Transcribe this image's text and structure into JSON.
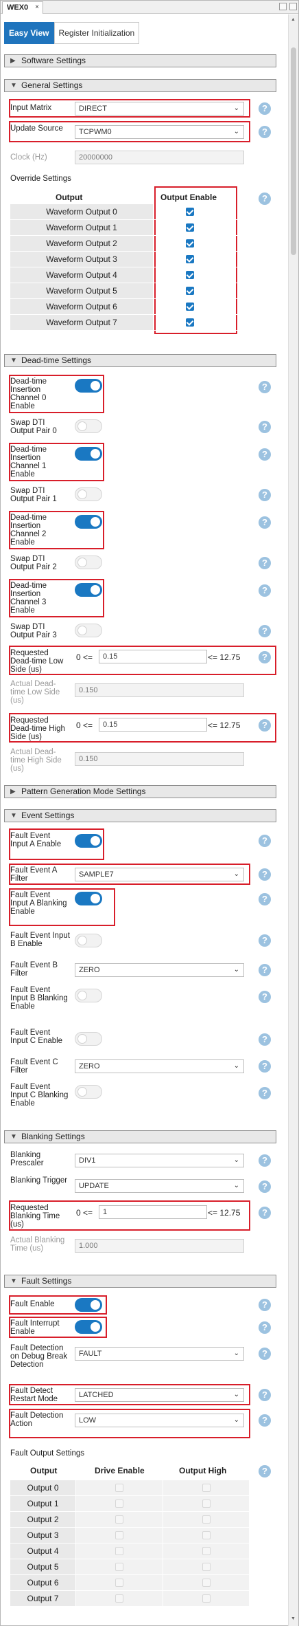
{
  "window": {
    "tab_label": "WEX0",
    "close": "×"
  },
  "view_tabs": {
    "easy": "Easy View",
    "register": "Register Initialization"
  },
  "sections": {
    "software": "Software Settings",
    "general": "General Settings",
    "deadtime": "Dead-time Settings",
    "pattern": "Pattern Generation Mode Settings",
    "event": "Event Settings",
    "blanking": "Blanking Settings",
    "fault": "Fault Settings"
  },
  "help_glyph": "?",
  "general": {
    "input_matrix": {
      "label": "Input Matrix",
      "value": "DIRECT"
    },
    "update_source": {
      "label": "Update Source",
      "value": "TCPWM0"
    },
    "clock": {
      "label": "Clock (Hz)",
      "value": "20000000"
    },
    "override_title": "Override Settings",
    "override_cols": [
      "Output",
      "Output Enable"
    ],
    "override_rows": [
      "Waveform Output 0",
      "Waveform Output 1",
      "Waveform Output 2",
      "Waveform Output 3",
      "Waveform Output 4",
      "Waveform Output 5",
      "Waveform Output 6",
      "Waveform Output 7"
    ],
    "override_enabled": [
      true,
      true,
      true,
      true,
      true,
      true,
      true,
      true
    ]
  },
  "deadtime": {
    "dti0": {
      "label": "Dead-time Insertion Channel 0 Enable",
      "on": true
    },
    "swap0": {
      "label": "Swap DTI Output Pair 0",
      "on": false
    },
    "dti1": {
      "label": "Dead-time Insertion Channel 1 Enable",
      "on": true
    },
    "swap1": {
      "label": "Swap DTI Output Pair 1",
      "on": false
    },
    "dti2": {
      "label": "Dead-time Insertion Channel 2 Enable",
      "on": true
    },
    "swap2": {
      "label": "Swap DTI Output Pair 2",
      "on": false
    },
    "dti3": {
      "label": "Dead-time Insertion Channel 3 Enable",
      "on": true
    },
    "swap3": {
      "label": "Swap DTI Output Pair 3",
      "on": false
    },
    "low": {
      "label": "Requested Dead-time Low Side (us)",
      "min": "0 <=",
      "value": "0.15",
      "max": "<= 12.75"
    },
    "actual_low": {
      "label": "Actual Dead-time Low Side (us)",
      "value": "0.150"
    },
    "high": {
      "label": "Requested Dead-time High Side (us)",
      "min": "0 <=",
      "value": "0.15",
      "max": "<= 12.75"
    },
    "actual_high": {
      "label": "Actual Dead-time High Side (us)",
      "value": "0.150"
    }
  },
  "event": {
    "fa_en": {
      "label": "Fault Event Input A Enable",
      "on": true
    },
    "fa_filter": {
      "label": "Fault Event A Filter",
      "value": "SAMPLE7"
    },
    "fa_blank": {
      "label": "Fault Event Input A Blanking Enable",
      "on": true
    },
    "fb_en": {
      "label": "Fault Event Input B Enable",
      "on": false
    },
    "fb_filter": {
      "label": "Fault Event B Filter",
      "value": "ZERO"
    },
    "fb_blank": {
      "label": "Fault Event Input B Blanking Enable",
      "on": false
    },
    "fc_en": {
      "label": "Fault Event Input C Enable",
      "on": false
    },
    "fc_filter": {
      "label": "Fault Event C Filter",
      "value": "ZERO"
    },
    "fc_blank": {
      "label": "Fault Event Input C Blanking Enable",
      "on": false
    }
  },
  "blanking": {
    "prescaler": {
      "label": "Blanking Prescaler",
      "value": "DIV1"
    },
    "trigger": {
      "label": "Blanking Trigger",
      "value": "UPDATE"
    },
    "req": {
      "label": "Requested Blanking Time (us)",
      "min": "0 <=",
      "value": "1",
      "max": "<= 12.75"
    },
    "actual": {
      "label": "Actual Blanking Time (us)",
      "value": "1.000"
    }
  },
  "fault": {
    "enable": {
      "label": "Fault Enable",
      "on": true
    },
    "interrupt": {
      "label": "Fault Interrupt Enable",
      "on": true
    },
    "debug": {
      "label": "Fault Detection on Debug Break Detection",
      "value": "FAULT"
    },
    "restart": {
      "label": "Fault Detect Restart Mode",
      "value": "LATCHED"
    },
    "action": {
      "label": "Fault Detection Action",
      "value": "LOW"
    },
    "output_title": "Fault Output Settings",
    "output_cols": [
      "Output",
      "Drive Enable",
      "Output High"
    ],
    "output_rows": [
      "Output 0",
      "Output 1",
      "Output 2",
      "Output 3",
      "Output 4",
      "Output 5",
      "Output 6",
      "Output 7"
    ]
  },
  "colors": {
    "accent": "#1a78c2",
    "highlight": "#d81e2a",
    "help": "#9cc2e0"
  }
}
